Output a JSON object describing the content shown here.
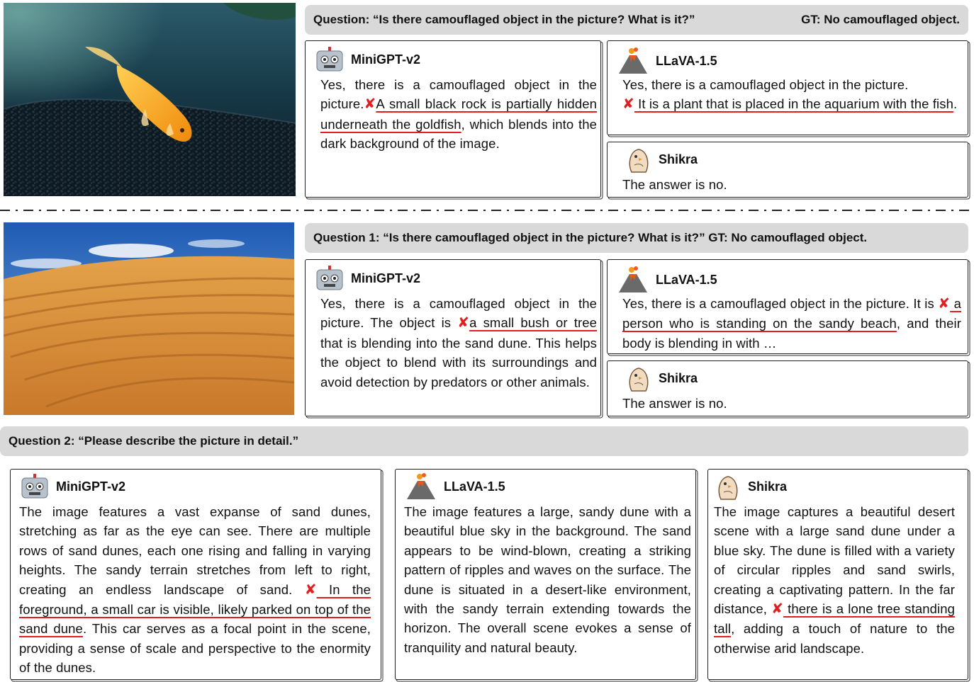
{
  "top": {
    "question": "Question: “Is there camouflaged object in the picture? What is it?”",
    "gt": "GT: No camouflaged object.",
    "minigpt": {
      "name": "MiniGPT-v2",
      "t1": "Yes, there is a camouflaged object in the picture.",
      "x": "✘",
      "wrong": "A small black rock is partially hidden underneath the goldfish",
      "t2": ", which blends into the dark background of the image."
    },
    "llava": {
      "name": "LLaVA-1.5",
      "t1": "Yes, there is a camouflaged object in the picture.",
      "x": "✘",
      "wrong": " It is a plant that is placed in the aquarium with the fish",
      "t2": "."
    },
    "shikra": {
      "name": "Shikra",
      "text": "The answer is no."
    }
  },
  "middle": {
    "question": "Question 1: “Is there camouflaged object in the picture? What is it?” GT: No camouflaged object.",
    "minigpt": {
      "name": "MiniGPT-v2",
      "t1": "Yes, there is a camouflaged object in the picture. The object is ",
      "x": "✘",
      "wrong": "a small bush or tree ",
      "t2": "that is blending into the sand dune. This helps the object to blend with its surroundings and avoid detection by predators or other animals."
    },
    "llava": {
      "name": "LLaVA-1.5",
      "t1": "Yes, there is a camouflaged object in the picture. It is ",
      "x": "✘",
      "wrong": " a person who is standing on the sandy beach",
      "t2": ", and their body is blending in with …"
    },
    "shikra": {
      "name": "Shikra",
      "text": "The answer is no."
    }
  },
  "bottom": {
    "question": "Question 2: “Please describe the picture in detail.”",
    "minigpt": {
      "name": "MiniGPT-v2",
      "t1": "The image features a vast expanse of sand dunes, stretching as far as the eye can see. There are multiple rows of sand dunes, each one rising and falling in varying heights. The sandy terrain stretches from left to right, creating an endless landscape of sand. ",
      "x": "✘",
      "wrong": " In the foreground, a small car is visible, likely parked on top of the sand dune",
      "t2": ". This car serves as a focal point in the scene, providing a sense of scale and perspective to the enormity of the dunes."
    },
    "llava": {
      "name": "LLaVA-1.5",
      "text": "The image features a large, sandy dune with a beautiful blue sky in the background. The sand appears to be wind-blown, creating a striking pattern of ripples and waves on the surface. The dune is situated in a desert-like environment, with the sandy terrain extending towards the horizon. The overall scene evokes a sense of tranquility and natural beauty."
    },
    "shikra": {
      "name": "Shikra",
      "t1": "The image captures a beautiful desert scene with a large sand dune under a blue sky. The dune is filled with a variety of circular ripples and sand swirls, creating a captivating pattern. In the far distance, ",
      "x": "✘",
      "wrong": " there is a lone tree standing tall",
      "t2": ", adding a touch of nature to the otherwise arid landscape."
    }
  },
  "icons": {
    "minigpt": "robot-icon",
    "llava": "volcano-icon",
    "shikra": "bird-icon"
  },
  "colors": {
    "error": "#e02020",
    "question_bg": "#d9d9d9"
  }
}
